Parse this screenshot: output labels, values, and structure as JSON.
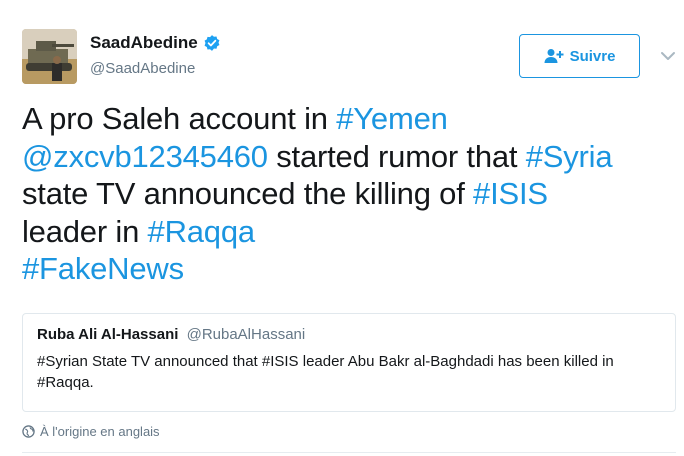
{
  "author": {
    "display_name": "SaadAbedine",
    "handle": "@SaadAbedine",
    "verified": true
  },
  "follow_button": {
    "label": "Suivre",
    "icon": "add-user-icon"
  },
  "tweet": {
    "segments": [
      {
        "text": "A pro Saleh account in ",
        "link": false
      },
      {
        "text": "#Yemen",
        "link": true
      },
      {
        "text": "\n",
        "link": false
      },
      {
        "text": "@zxcvb12345460",
        "link": true
      },
      {
        "text": " started rumor that ",
        "link": false
      },
      {
        "text": "#Syria",
        "link": true
      },
      {
        "text": "\nstate TV announced the killing of ",
        "link": false
      },
      {
        "text": "#ISIS",
        "link": true
      },
      {
        "text": "\nleader in ",
        "link": false
      },
      {
        "text": "#Raqqa",
        "link": true
      },
      {
        "text": "\n",
        "link": false
      },
      {
        "text": "#FakeNews",
        "link": true
      }
    ]
  },
  "quoted_tweet": {
    "display_name": "Ruba Ali Al-Hassani",
    "handle": "@RubaAlHassani",
    "text": "#Syrian State TV announced that #ISIS leader Abu Bakr al-Baghdadi has been killed in #Raqqa."
  },
  "translation_note": {
    "icon": "globe-icon",
    "label": "À l'origine en anglais"
  },
  "colors": {
    "accent": "#1b95e0",
    "text": "#14171a",
    "muted": "#657786",
    "border": "#e1e8ed"
  }
}
